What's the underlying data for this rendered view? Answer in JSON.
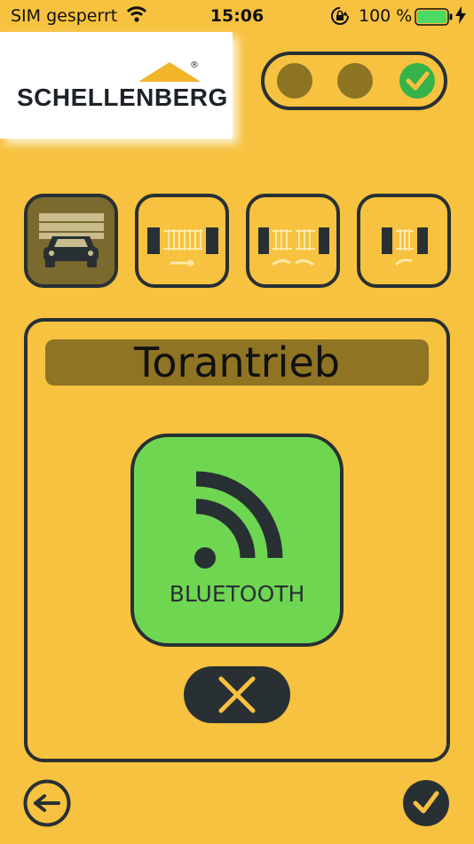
{
  "status_bar": {
    "carrier": "SIM gesperrt",
    "time": "15:06",
    "battery_percent": "100 %",
    "icons": [
      "wifi-icon",
      "orientation-lock-icon",
      "battery-icon",
      "charging-bolt-icon"
    ]
  },
  "logo": {
    "brand": "SCHELLENBERG",
    "registered_mark": "®"
  },
  "connection_indicator": {
    "steps": [
      {
        "name": "step-1",
        "state": "inactive"
      },
      {
        "name": "step-2",
        "state": "inactive"
      },
      {
        "name": "step-3",
        "state": "complete"
      }
    ]
  },
  "modes": [
    {
      "name": "garage-door",
      "active": true,
      "icon": "garage-car-icon"
    },
    {
      "name": "sliding-gate",
      "active": false,
      "icon": "sliding-gate-icon"
    },
    {
      "name": "double-wing-gate",
      "active": false,
      "icon": "double-gate-icon"
    },
    {
      "name": "single-wing-gate",
      "active": false,
      "icon": "single-gate-icon"
    }
  ],
  "panel": {
    "title": "Torantrieb",
    "bluetooth_label": "BLUETOOTH"
  },
  "colors": {
    "background": "#F7C23F",
    "dark": "#283034",
    "bluetooth_green": "#6FD651",
    "check_green": "#35B34A",
    "title_bar": "#8F7424"
  }
}
